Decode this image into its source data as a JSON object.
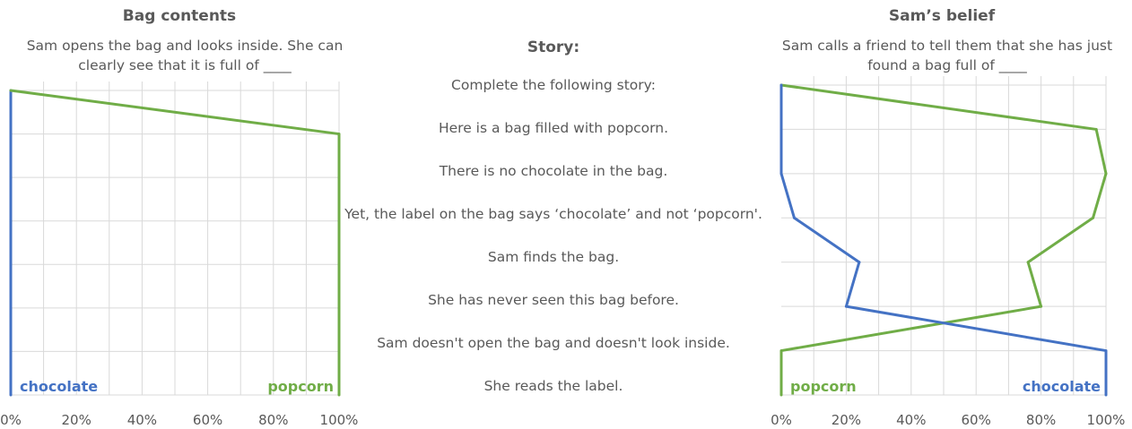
{
  "story": {
    "heading": "Story:",
    "lines": [
      "Complete the following story:",
      "Here is a bag filled with popcorn.",
      "There is no chocolate in the bag.",
      "Yet, the label on the bag says ‘chocolate’ and not ‘popcorn'.",
      "Sam finds the bag.",
      "She has never seen this bag before.",
      "Sam doesn't open the bag and doesn't look inside.",
      "She reads the label."
    ]
  },
  "colors": {
    "chocolate": "#4472C4",
    "popcorn": "#70AD47",
    "grid": "#D9D9D9",
    "text": "#595959"
  },
  "chart_data": [
    {
      "type": "line",
      "title": "Bag contents",
      "subtitle": "Sam opens the bag and looks inside. She can clearly see that it is full of ____",
      "x_ticks": [
        "0%",
        "20%",
        "40%",
        "60%",
        "80%",
        "100%"
      ],
      "xlim": [
        0,
        100
      ],
      "steps": 8,
      "series": [
        {
          "name": "chocolate",
          "label_position": "left",
          "values": [
            0,
            0,
            0,
            0,
            0,
            0,
            0,
            0
          ]
        },
        {
          "name": "popcorn",
          "label_position": "right",
          "values": [
            0,
            100,
            100,
            100,
            100,
            100,
            100,
            100
          ]
        }
      ]
    },
    {
      "type": "line",
      "title": "Sam’s belief",
      "subtitle": "Sam calls a friend to tell them that she has just found a bag full of ____",
      "x_ticks": [
        "0%",
        "20%",
        "40%",
        "60%",
        "80%",
        "100%"
      ],
      "xlim": [
        0,
        100
      ],
      "steps": 8,
      "series": [
        {
          "name": "popcorn",
          "label_position": "left",
          "values": [
            0,
            97,
            100,
            96,
            76,
            80,
            0,
            0
          ]
        },
        {
          "name": "chocolate",
          "label_position": "right",
          "values": [
            0,
            0,
            0,
            4,
            24,
            20,
            100,
            100
          ]
        }
      ]
    }
  ]
}
